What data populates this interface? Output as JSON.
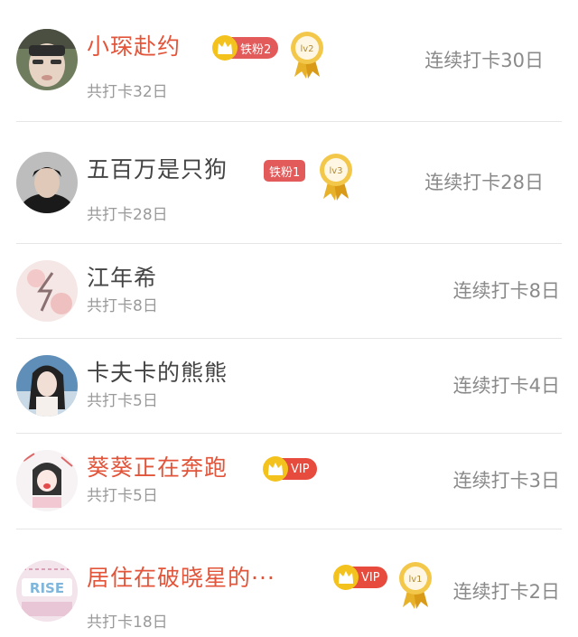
{
  "rows": [
    {
      "name": "小琛赴约",
      "badge": "铁粉2",
      "medal": "lv2",
      "total": "共打卡32日",
      "streak": "连续打卡30日"
    },
    {
      "name": "五百万是只狗",
      "badge": "铁粉1",
      "medal": "lv3",
      "total": "共打卡28日",
      "streak": "连续打卡28日"
    },
    {
      "name": "江年希",
      "total": "共打卡8日",
      "streak": "连续打卡8日"
    },
    {
      "name": "卡夫卡的熊熊",
      "total": "共打卡5日",
      "streak": "连续打卡4日"
    },
    {
      "name": "葵葵正在奔跑",
      "badge": "VIP",
      "total": "共打卡5日",
      "streak": "连续打卡3日"
    },
    {
      "name": "居住在破晓星的···",
      "badge": "VIP",
      "medal": "lv1",
      "total": "共打卡18日",
      "streak": "连续打卡2日"
    }
  ],
  "colors": {
    "highlight_name": "#e2553a",
    "normal_name": "#444444",
    "secondary_text": "#9a9a9a",
    "fan_badge": "#e25a5a",
    "vip_badge": "#e64b3d",
    "divider": "#e6e6e6"
  },
  "icons": {
    "crown": "crown-icon",
    "medal": "medal-icon"
  }
}
